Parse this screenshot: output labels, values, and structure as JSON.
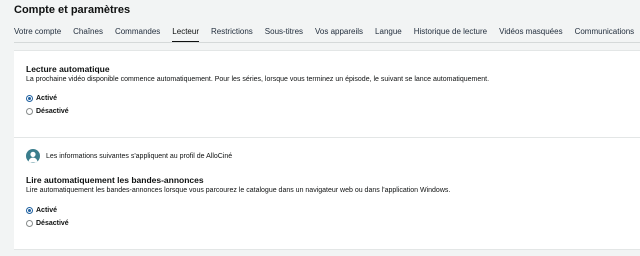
{
  "header": {
    "title": "Compte et paramètres"
  },
  "tabs": [
    {
      "label": "Votre compte",
      "active": false
    },
    {
      "label": "Chaînes",
      "active": false
    },
    {
      "label": "Commandes",
      "active": false
    },
    {
      "label": "Lecteur",
      "active": true
    },
    {
      "label": "Restrictions",
      "active": false
    },
    {
      "label": "Sous-titres",
      "active": false
    },
    {
      "label": "Vos appareils",
      "active": false
    },
    {
      "label": "Langue",
      "active": false
    },
    {
      "label": "Historique de lecture",
      "active": false
    },
    {
      "label": "Vidéos masquées",
      "active": false
    },
    {
      "label": "Communications",
      "active": false
    }
  ],
  "autoplay": {
    "title": "Lecture automatique",
    "description": "La prochaine vidéo disponible commence automatiquement. Pour les séries, lorsque vous terminez un épisode, le suivant se lance automatiquement.",
    "options": [
      {
        "label": "Activé",
        "checked": true
      },
      {
        "label": "Désactivé",
        "checked": false
      }
    ]
  },
  "profile_notice": {
    "text": "Les informations suivantes s'appliquent au profil de AlloCiné",
    "avatar_icon": "user-avatar-icon"
  },
  "trailers": {
    "title": "Lire automatiquement les bandes-annonces",
    "description": "Lire automatiquement les bandes-annonces lorsque vous parcourez le catalogue dans un navigateur web ou dans l'application Windows.",
    "options": [
      {
        "label": "Activé",
        "checked": true
      },
      {
        "label": "Désactivé",
        "checked": false
      }
    ]
  },
  "colors": {
    "background": "#f2f4f4",
    "card": "#ffffff",
    "radio_accent": "#2162a1",
    "avatar": "#3a7d8c"
  }
}
